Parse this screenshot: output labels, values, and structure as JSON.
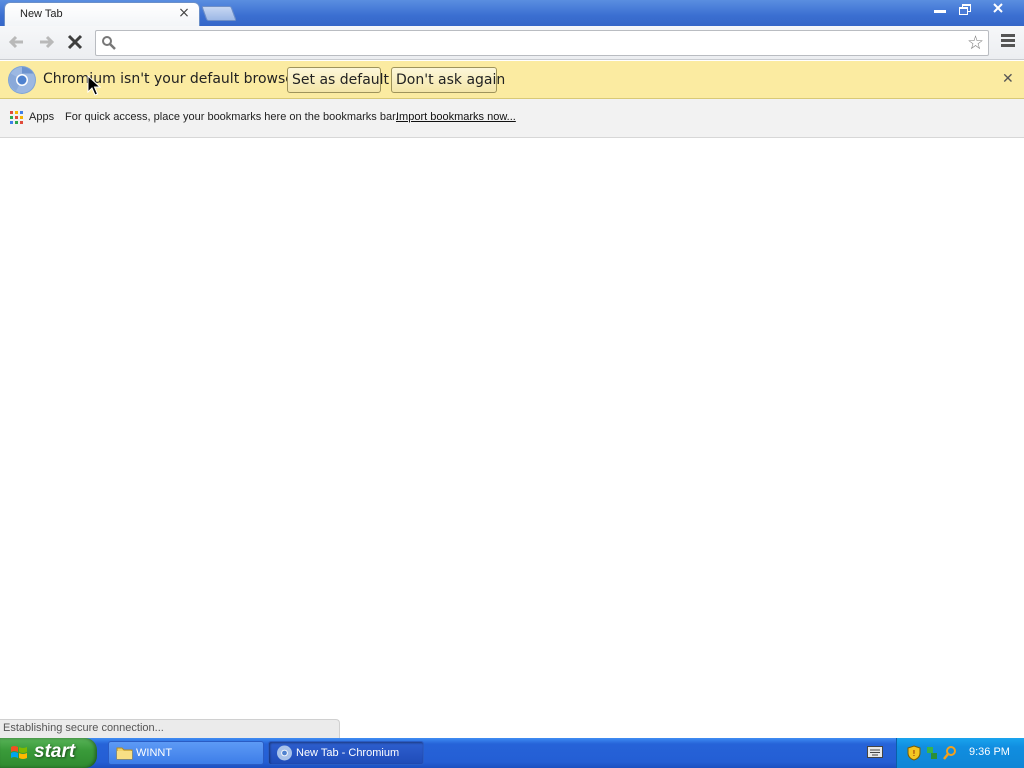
{
  "browser": {
    "tab_title": "New Tab",
    "omnibox_value": "",
    "omnibox_placeholder": ""
  },
  "infobar": {
    "message": "Chromium isn't your default browser.",
    "set_default_label": "Set as default",
    "dont_ask_label": "Don't ask again"
  },
  "bookmarks": {
    "apps_label": "Apps",
    "hint": "For quick access, place your bookmarks here on the bookmarks bar.",
    "import_link": "Import bookmarks now..."
  },
  "status": {
    "text": "Establishing secure connection..."
  },
  "taskbar": {
    "start_label": "start",
    "items": [
      {
        "label": "WINNT",
        "icon": "folder-icon"
      },
      {
        "label": "New Tab - Chromium",
        "icon": "chromium-icon"
      }
    ],
    "clock": "9:36 PM"
  },
  "colors": {
    "titlebar": "#3b6fd1",
    "infobar": "#fbeba1",
    "taskbar": "#245ed4",
    "start_button": "#3a9b3a",
    "tray": "#118ee0"
  }
}
